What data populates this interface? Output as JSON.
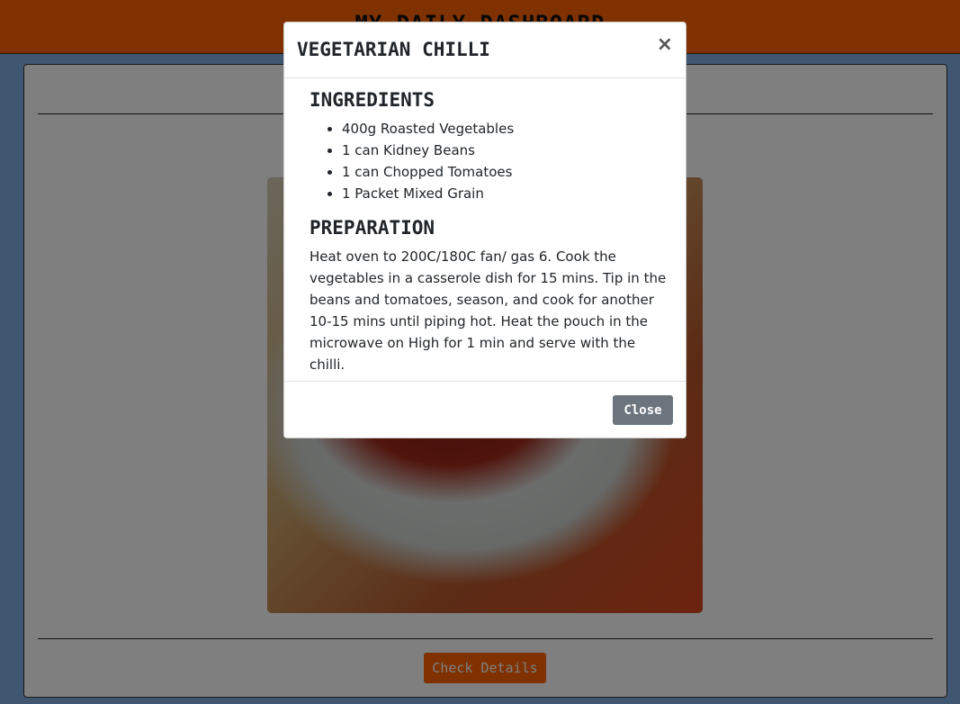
{
  "header": {
    "title": "MY DAILY DASHBOARD"
  },
  "card": {
    "check_details_label": "Check Details"
  },
  "modal": {
    "title": "VEGETARIAN CHILLI",
    "close_x": "×",
    "ingredients_heading": "INGREDIENTS",
    "ingredients": [
      "400g Roasted Vegetables",
      "1 can Kidney Beans",
      "1 can Chopped Tomatoes",
      "1 Packet Mixed Grain"
    ],
    "preparation_heading": "PREPARATION",
    "preparation_text": "Heat oven to 200C/180C fan/ gas 6. Cook the vegetables in a casserole dish for 15 mins. Tip in the beans and tomatoes, season, and cook for another 10-15 mins until piping hot. Heat the pouch in the microwave on High for 1 min and serve with the chilli.",
    "close_label": "Close"
  },
  "colors": {
    "header_bg": "#ff6400",
    "page_bg": "#80aee4",
    "close_button_bg": "#6c757d"
  }
}
